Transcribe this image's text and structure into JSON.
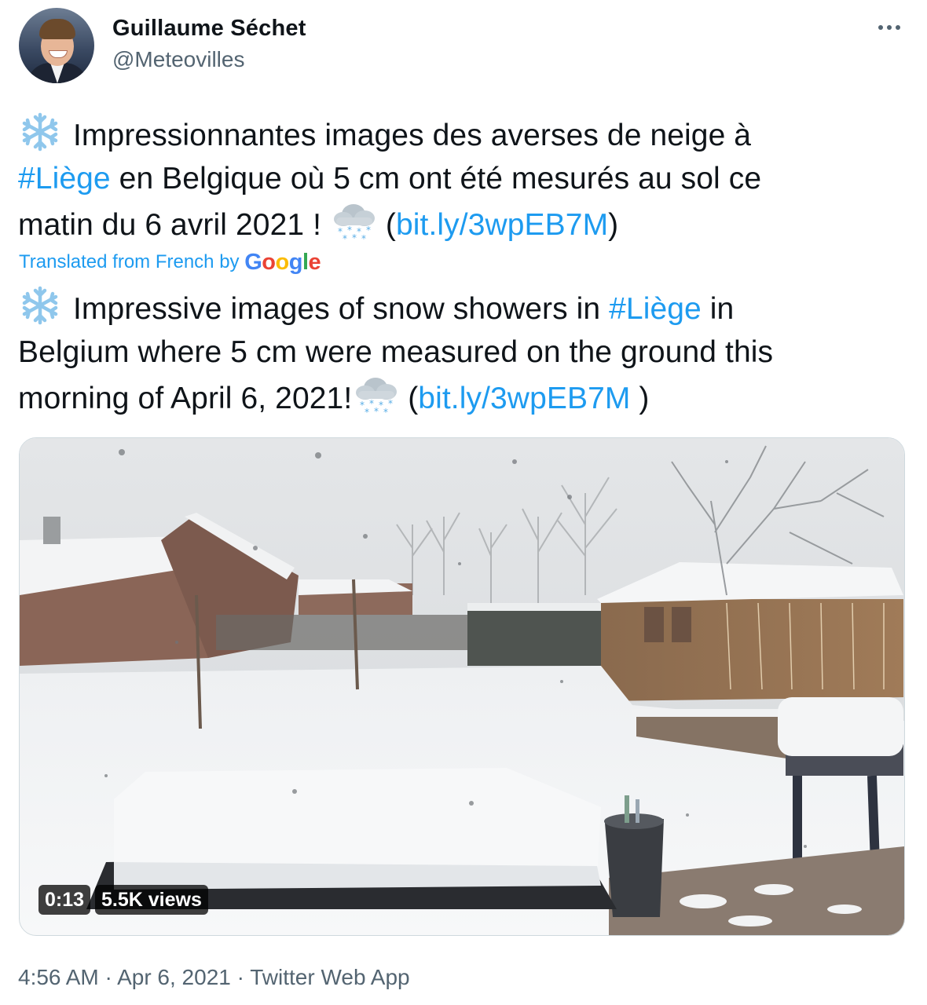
{
  "author": {
    "name": "Guillaume Séchet",
    "handle": "@Meteovilles"
  },
  "icons": {
    "more": "more-horizontal-icon",
    "snowflake": "snowflake-emoji",
    "cloud_snow": "cloud-with-snow-emoji"
  },
  "original_text": {
    "line1_text": "Impressionnantes images des averses de neige à",
    "hashtag": "#Liège",
    "line2_text": " en Belgique où 5 cm ont été mesurés au sol ce",
    "line3_text": "matin du 6 avril 2021 ! ",
    "paren_open": " (",
    "link": "bit.ly/3wpEB7M",
    "paren_close": ")"
  },
  "translation_note": {
    "prefix": "Translated from French by",
    "provider": "Google"
  },
  "translated_text": {
    "line1_text": "Impressive images of snow showers in ",
    "hashtag": "#Liège",
    "line1_end": " in",
    "line2_text": "Belgium where 5 cm were measured on the ground this",
    "line3_text": "morning of April 6, 2021!",
    "paren_open": " (",
    "link": "bit.ly/3wpEB7M",
    "paren_close": " )"
  },
  "media": {
    "type": "video",
    "duration": "0:13",
    "views": "5.5K views"
  },
  "meta": {
    "time": "4:56 AM",
    "date": "Apr 6, 2021",
    "client": "Twitter Web App",
    "separator": " · "
  },
  "colors": {
    "link": "#1d9bf0",
    "secondary_text": "#536471",
    "primary_text": "#0f1419"
  }
}
